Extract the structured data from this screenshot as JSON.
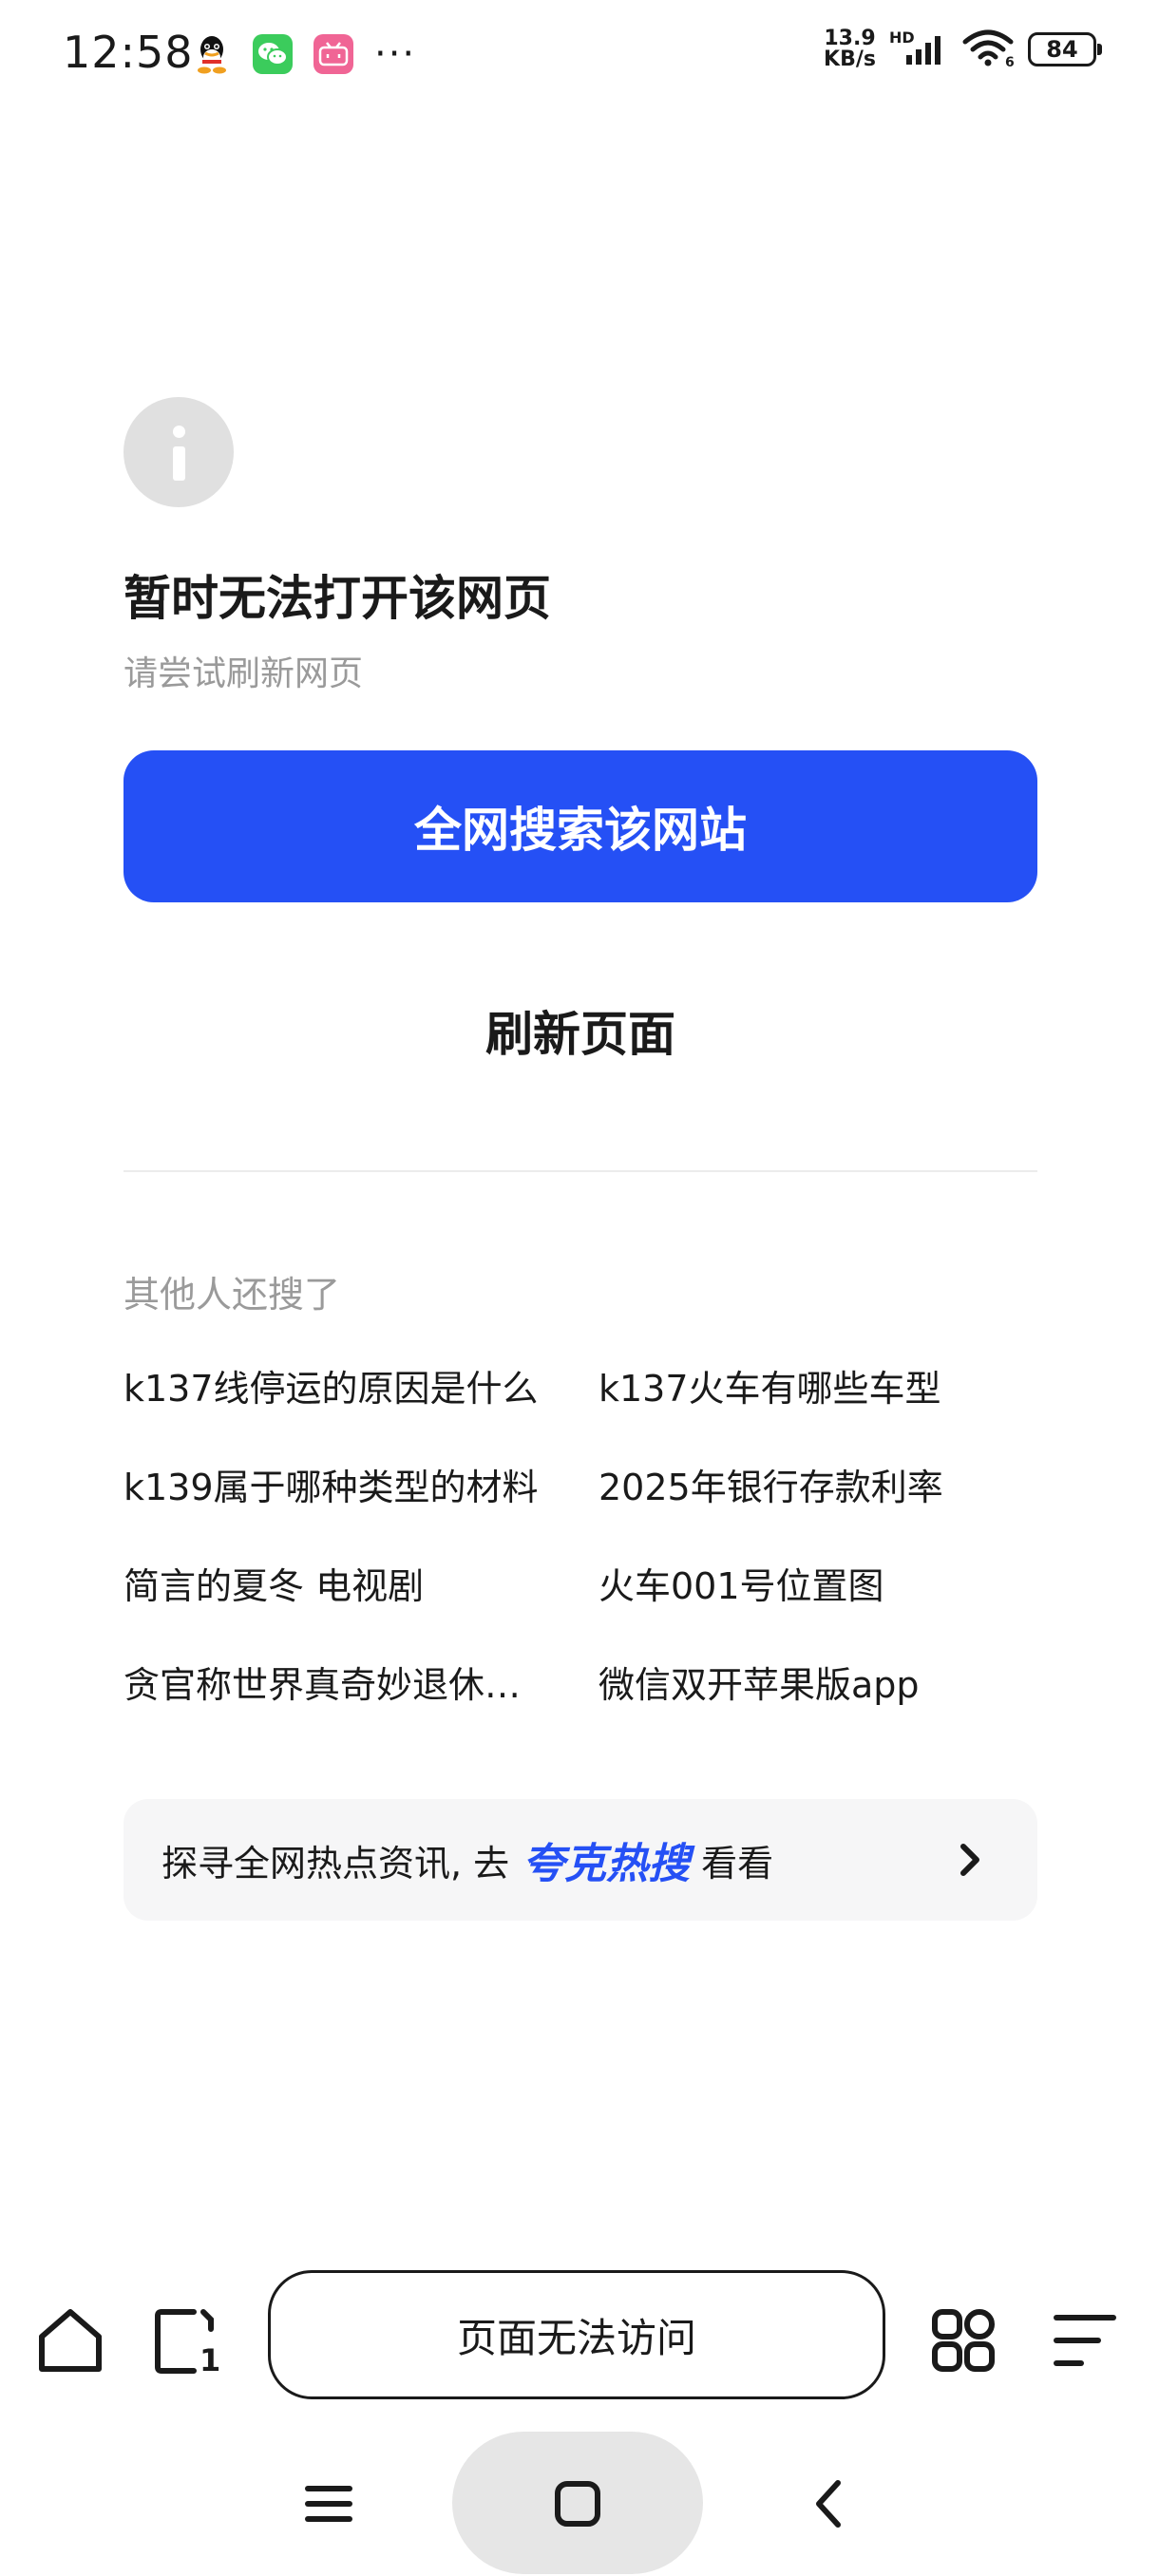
{
  "status_bar": {
    "time": "12:58",
    "net_speed_value": "13.9",
    "net_speed_unit": "KB/s",
    "hd_label": "HD",
    "battery": "84",
    "more": "···"
  },
  "error": {
    "title": "暂时无法打开该网页",
    "subtitle": "请尝试刷新网页",
    "primary_button": "全网搜索该网站",
    "refresh_button": "刷新页面"
  },
  "related": {
    "title": "其他人还搜了",
    "items": [
      "k137线停运的原因是什么",
      "k137火车有哪些车型",
      "k139属于哪种类型的材料",
      "2025年银行存款利率",
      "简言的夏冬 电视剧",
      "火车001号位置图",
      "贪官称世界真奇妙退休…",
      "微信双开苹果版app"
    ]
  },
  "hot_banner": {
    "prefix": "探寻全网热点资讯, 去",
    "brand": "夸克热搜",
    "suffix": "看看"
  },
  "toolbar": {
    "address_text": "页面无法访问",
    "tab_count": "1"
  },
  "colors": {
    "accent": "#2550f5",
    "muted_text": "#9a9a9a",
    "icon_circle": "#e0e0e0",
    "banner_bg": "#f6f6f7"
  }
}
